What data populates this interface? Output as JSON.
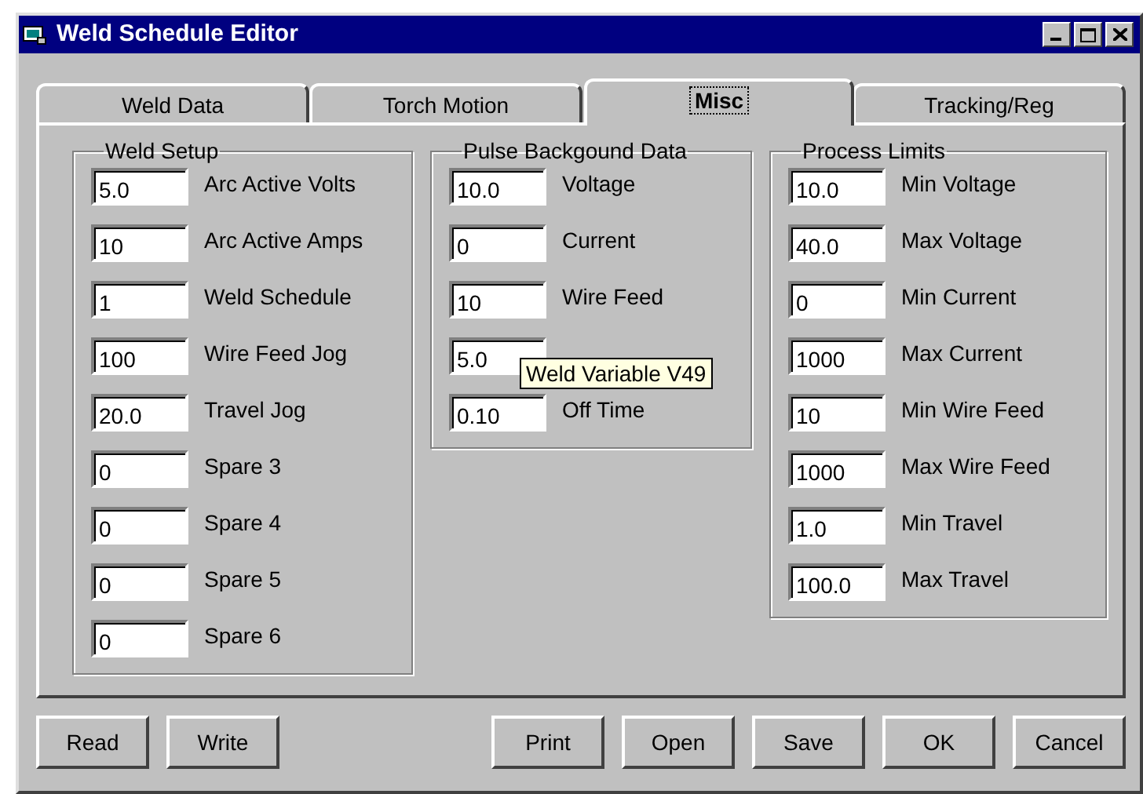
{
  "window": {
    "title": "Weld Schedule Editor"
  },
  "tabs": [
    {
      "label": "Weld Data",
      "selected": false
    },
    {
      "label": "Torch Motion",
      "selected": false
    },
    {
      "label": "Misc",
      "selected": true
    },
    {
      "label": "Tracking/Reg",
      "selected": false
    }
  ],
  "groups": [
    {
      "title": "Weld Setup",
      "fields": [
        {
          "value": "5.0",
          "label": "Arc Active Volts"
        },
        {
          "value": "10",
          "label": "Arc Active Amps"
        },
        {
          "value": "1",
          "label": "Weld Schedule"
        },
        {
          "value": "100",
          "label": "Wire Feed Jog"
        },
        {
          "value": "20.0",
          "label": "Travel Jog"
        },
        {
          "value": "0",
          "label": "Spare 3"
        },
        {
          "value": "0",
          "label": "Spare 4"
        },
        {
          "value": "0",
          "label": "Spare 5"
        },
        {
          "value": "0",
          "label": "Spare 6"
        }
      ]
    },
    {
      "title": "Pulse Backgound Data",
      "fields": [
        {
          "value": "10.0",
          "label": "Voltage"
        },
        {
          "value": "0",
          "label": "Current"
        },
        {
          "value": "10",
          "label": "Wire Feed"
        },
        {
          "value": "5.0",
          "tooltip": "Weld Variable V49"
        },
        {
          "value": "0.10",
          "label": "Off Time"
        }
      ]
    },
    {
      "title": "Process Limits",
      "fields": [
        {
          "value": "10.0",
          "label": "Min Voltage"
        },
        {
          "value": "40.0",
          "label": "Max Voltage"
        },
        {
          "value": "0",
          "label": "Min Current"
        },
        {
          "value": "1000",
          "label": "Max Current"
        },
        {
          "value": "10",
          "label": "Min Wire Feed"
        },
        {
          "value": "1000",
          "label": "Max Wire Feed"
        },
        {
          "value": "1.0",
          "label": "Min Travel"
        },
        {
          "value": "100.0",
          "label": "Max Travel"
        }
      ]
    }
  ],
  "buttons_left": [
    "Read",
    "Write"
  ],
  "buttons_right": [
    "Print",
    "Open",
    "Save",
    "OK",
    "Cancel"
  ]
}
